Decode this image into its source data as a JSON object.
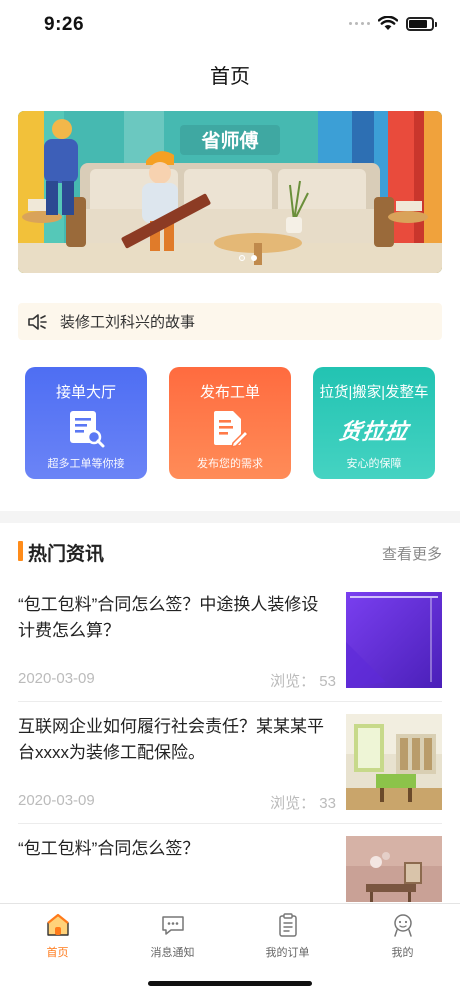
{
  "status_bar": {
    "time": "9:26"
  },
  "nav": {
    "title": "首页"
  },
  "banner": {
    "brand_text": "省师傅",
    "slide_count": 2,
    "active_index": 1
  },
  "notice": {
    "text": "装修工刘科兴的故事"
  },
  "cards": [
    {
      "title": "接单大厅",
      "subtitle": "超多工单等你接",
      "icon": "document-search-icon",
      "color": "#4e6ef3"
    },
    {
      "title": "发布工单",
      "subtitle": "发布您的需求",
      "icon": "document-edit-icon",
      "color": "#ff6b3f"
    },
    {
      "title": "拉货|搬家|发整车",
      "subtitle": "安心的保障",
      "logo": "货拉拉",
      "color": "#22c3b2"
    }
  ],
  "section": {
    "title": "热门资讯",
    "more": "查看更多",
    "accent": "#ff8c1a"
  },
  "news": [
    {
      "title": "“包工包料”合同怎么签？中途换人装修设计费怎么算？",
      "date": "2020-03-09",
      "views": "浏览：  53"
    },
    {
      "title": "互联网企业如何履行社会责任？某某某平台xxxx为装修工配保险。",
      "date": "2020-03-09",
      "views": "浏览：  33"
    },
    {
      "title": "“包工包料”合同怎么签？",
      "date": "",
      "views": ""
    }
  ],
  "tabs": [
    {
      "label": "首页",
      "icon": "home-icon",
      "active": true
    },
    {
      "label": "消息通知",
      "icon": "message-icon",
      "active": false
    },
    {
      "label": "我的订单",
      "icon": "clipboard-icon",
      "active": false
    },
    {
      "label": "我的",
      "icon": "user-icon",
      "active": false
    }
  ]
}
